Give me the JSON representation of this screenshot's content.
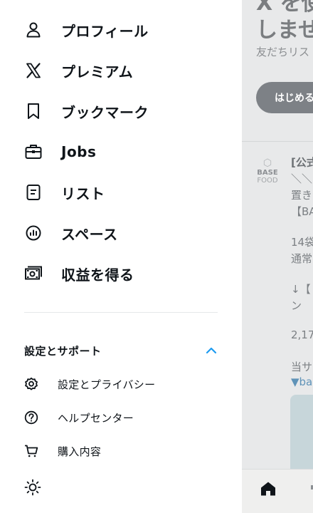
{
  "drawer": {
    "items": [
      {
        "id": "profile",
        "label": "プロフィール",
        "icon": "person-icon"
      },
      {
        "id": "premium",
        "label": "プレミアム",
        "icon": "x-logo-icon"
      },
      {
        "id": "bookmarks",
        "label": "ブックマーク",
        "icon": "bookmark-icon"
      },
      {
        "id": "jobs",
        "label": "Jobs",
        "icon": "briefcase-icon"
      },
      {
        "id": "lists",
        "label": "リスト",
        "icon": "list-icon"
      },
      {
        "id": "spaces",
        "label": "スペース",
        "icon": "microphone-icon"
      },
      {
        "id": "monetization",
        "label": "収益を得る",
        "icon": "money-icon"
      }
    ],
    "settings_section": {
      "label": "設定とサポート",
      "expanded": true,
      "items": [
        {
          "id": "settings-privacy",
          "label": "設定とプライバシー",
          "icon": "gear-icon"
        },
        {
          "id": "help-center",
          "label": "ヘルプセンター",
          "icon": "help-icon"
        },
        {
          "id": "purchases",
          "label": "購入内容",
          "icon": "cart-icon"
        }
      ]
    },
    "display_toggle_icon": "sun-icon"
  },
  "background": {
    "heading": "X を使\nしませ",
    "subtitle": "友だちリス",
    "start_button": "はじめる",
    "post": {
      "logo_top": "BASE",
      "logo_bottom": "FOOD",
      "lines": [
        "[公式",
        "＼＼",
        "置き",
        "【BA",
        "14袋",
        "通常",
        "↓【",
        "ン",
        "2,17",
        "当サ",
        "▼ba"
      ]
    },
    "bottom_nav": {
      "home_icon": "home-icon"
    }
  },
  "colors": {
    "accent": "#1d9bf0",
    "text": "#0f1419"
  }
}
